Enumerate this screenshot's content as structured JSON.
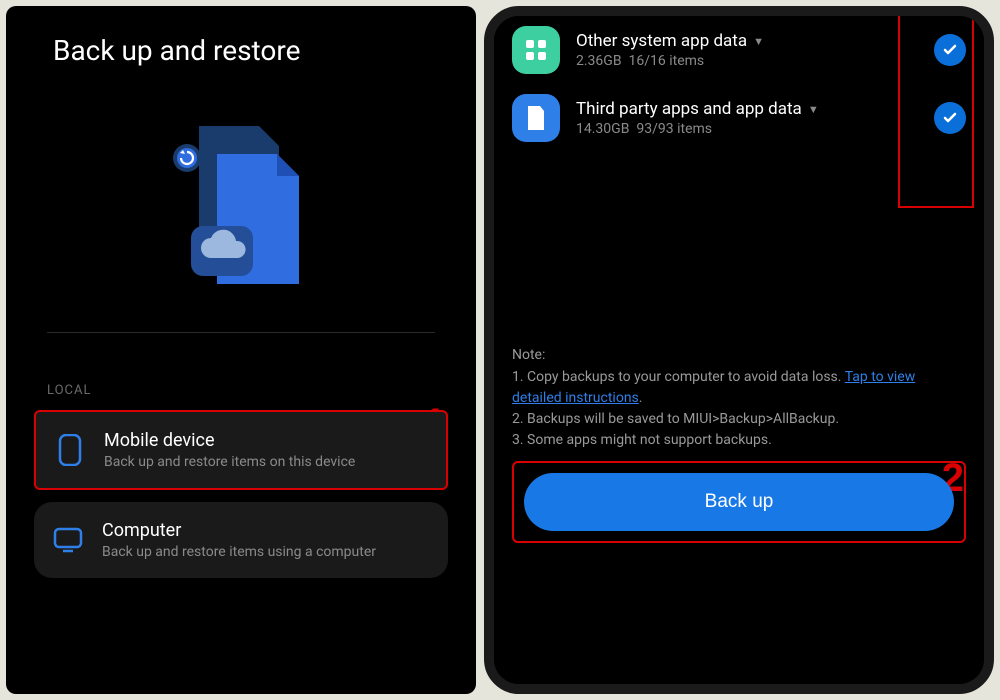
{
  "screen1": {
    "title": "Back up and restore",
    "section_label": "LOCAL",
    "annotation": "1",
    "items": [
      {
        "title": "Mobile device",
        "subtitle": "Back up and restore items on this device",
        "icon": "phone-icon"
      },
      {
        "title": "Computer",
        "subtitle": "Back up and restore items using a computer",
        "icon": "monitor-icon"
      }
    ]
  },
  "screen2": {
    "annotation": "2",
    "categories": [
      {
        "title": "Other system app data",
        "size": "2.36GB",
        "count": "16/16 items",
        "icon": "grid-icon",
        "iconbg": "green",
        "checked": true
      },
      {
        "title": "Third party apps and app data",
        "size": "14.30GB",
        "count": "93/93 items",
        "icon": "file-icon",
        "iconbg": "blue",
        "checked": true
      }
    ],
    "note": {
      "header": "Note:",
      "line1_prefix": "1. Copy backups to your computer to avoid data loss. ",
      "line1_link": "Tap to view detailed instructions",
      "line1_suffix": ".",
      "line2": "2. Backups will be saved to MIUI>Backup>AllBackup.",
      "line3": "3. Some apps might not support backups."
    },
    "button_label": "Back up"
  }
}
